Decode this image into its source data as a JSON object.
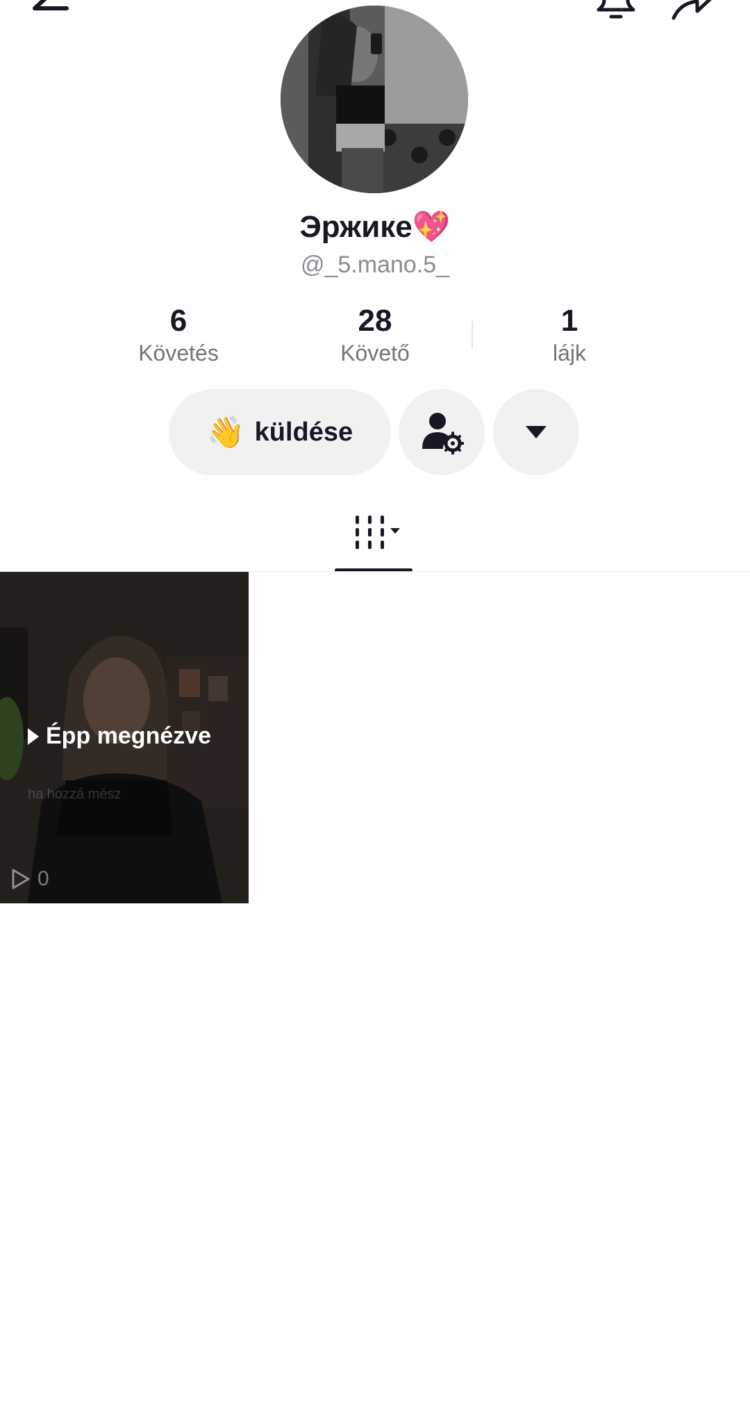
{
  "header": {
    "back_icon": "arrow-left-icon",
    "bell_icon": "bell-icon",
    "share_icon": "share-arrow-icon"
  },
  "profile": {
    "display_name": "Эржике💖",
    "username": "@_5.mano.5_"
  },
  "stats": [
    {
      "value": "6",
      "label": "Követés"
    },
    {
      "value": "28",
      "label": "Követő"
    },
    {
      "value": "1",
      "label": "lájk"
    }
  ],
  "actions": {
    "wave_emoji": "👋",
    "wave_label": "küldése",
    "user_settings_icon": "user-gear-icon",
    "more_icon": "caret-down-icon"
  },
  "tabs": {
    "videos_icon": "grid-columns-icon"
  },
  "videos": [
    {
      "overlay_label": "Épp megnézve",
      "caption": "ha hozzá mész",
      "views": "0"
    }
  ]
}
